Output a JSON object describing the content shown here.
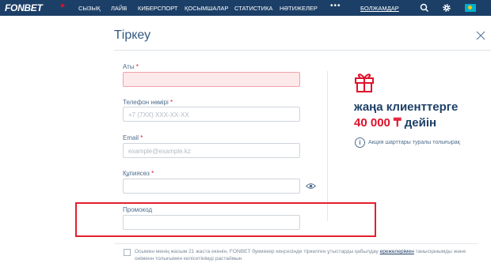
{
  "header": {
    "logo": "FONBET",
    "nav": [
      "СЫЗЫҚ",
      "ЛАЙВ",
      "КИБЕРСПОРТ",
      "ҚОСЫМШАЛАР",
      "СТАТИСТИКА",
      "НӘТИЖЕЛЕР"
    ],
    "more": "•••",
    "login": "БОЛЖАМДАР"
  },
  "modal": {
    "title": "Тіркеу",
    "fields": {
      "name": {
        "label": "Аты",
        "required": "*",
        "placeholder": ""
      },
      "phone": {
        "label": "Телефон нөмірі",
        "required": "*",
        "placeholder": "+7 (7XX) XXX-XX-XX"
      },
      "email": {
        "label": "Email",
        "required": "*",
        "placeholder": "example@example.kz"
      },
      "password": {
        "label": "Құпиясөз",
        "required": "*",
        "placeholder": ""
      },
      "promo": {
        "label": "Промокод",
        "placeholder": ""
      }
    },
    "promo_panel": {
      "line1": "жаңа клиенттерге",
      "amount": "40 000 ₸",
      "suffix": "дейін",
      "info_icon": "i",
      "info_text": "Акция шарттары туралы толығырақ"
    },
    "terms": {
      "before": "Осымен менің жасым 21 жаста екенін, FONBET букмекер кеңсесінде тіркелген ұтыстарды қабылдау ",
      "link": "ережелерімен",
      "after": " танысқанымды және оніменн толығымен келісетінімді растаймын"
    }
  },
  "colors": {
    "brand": "#1c3f67",
    "accent": "#e0112b",
    "highlight": "#e3202e"
  }
}
